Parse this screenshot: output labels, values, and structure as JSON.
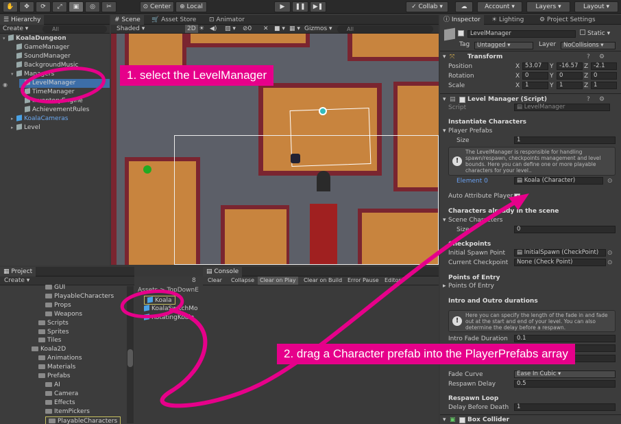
{
  "toolbar": {
    "pivot": "Center",
    "space": "Local",
    "collab": "Collab",
    "account": "Account",
    "layers": "Layers",
    "layout": "Layout"
  },
  "hierarchy": {
    "tab": "Hierarchy",
    "create": "Create",
    "search_placeholder": "All",
    "items": [
      {
        "label": "KoalaDungeon",
        "level": 0,
        "bold": true
      },
      {
        "label": "GameManager",
        "level": 1
      },
      {
        "label": "SoundManager",
        "level": 1
      },
      {
        "label": "BackgroundMusic",
        "level": 1
      },
      {
        "label": "Managers",
        "level": 1
      },
      {
        "label": "LevelManager",
        "level": 2
      },
      {
        "label": "TimeManager",
        "level": 2
      },
      {
        "label": "InventoryEngine",
        "level": 2
      },
      {
        "label": "AchievementRules",
        "level": 2
      },
      {
        "label": "KoalaCameras",
        "level": 1,
        "blue": true
      },
      {
        "label": "Level",
        "level": 1
      }
    ]
  },
  "scene": {
    "tabs": [
      "Scene",
      "Asset Store",
      "Animator"
    ],
    "shaded": "Shaded",
    "mode2d": "2D",
    "gizmos": "Gizmos",
    "search": "All"
  },
  "project": {
    "tab": "Project",
    "create": "Create",
    "items": [
      {
        "label": "GUI",
        "level": 2
      },
      {
        "label": "PlayableCharacters",
        "level": 2
      },
      {
        "label": "Props",
        "level": 2
      },
      {
        "label": "Weapons",
        "level": 2
      },
      {
        "label": "Scripts",
        "level": 1
      },
      {
        "label": "Sprites",
        "level": 1
      },
      {
        "label": "Tiles",
        "level": 1
      },
      {
        "label": "Koala2D",
        "level": 0
      },
      {
        "label": "Animations",
        "level": 1
      },
      {
        "label": "Materials",
        "level": 1
      },
      {
        "label": "Prefabs",
        "level": 1
      },
      {
        "label": "AI",
        "level": 2
      },
      {
        "label": "Camera",
        "level": 2
      },
      {
        "label": "Effects",
        "level": 2
      },
      {
        "label": "ItemPickers",
        "level": 2
      },
      {
        "label": "PlayableCharacters",
        "level": 2
      }
    ],
    "breadcrumb": "Assets > TopDownE",
    "count": "8",
    "assets": [
      "Koala",
      "KoalaSwitchMo",
      "RotatingKoala"
    ]
  },
  "console": {
    "tab": "Console",
    "buttons": [
      "Clear",
      "Collapse",
      "Clear on Play",
      "Clear on Build",
      "Error Pause",
      "Editor"
    ]
  },
  "inspector": {
    "tabs": [
      "Inspector",
      "Lighting",
      "Project Settings"
    ],
    "object_name": "LevelManager",
    "static": "Static",
    "tag_label": "Tag",
    "tag_value": "Untagged",
    "layer_label": "Layer",
    "layer_value": "NoCollisions",
    "transform": {
      "title": "Transform",
      "rows": [
        {
          "label": "Position",
          "x": "53.07",
          "y": "-16.57",
          "z": "-2.1"
        },
        {
          "label": "Rotation",
          "x": "0",
          "y": "0",
          "z": "0"
        },
        {
          "label": "Scale",
          "x": "1",
          "y": "1",
          "z": "1"
        }
      ]
    },
    "level_manager": {
      "title": "Level Manager (Script)",
      "script_label": "Script",
      "script_value": "LevelManager",
      "instantiate": "Instantiate Characters",
      "player_prefabs": "Player Prefabs",
      "size_label": "Size",
      "size_value": "1",
      "help1": "The LevelManager is responsible for handling spawn/respawn, checkpoints management and level bounds. Here you can define one or more playable characters for your level..",
      "element0_label": "Element 0",
      "element0_value": "Koala (Character)",
      "auto_attr": "Auto Attribute Player",
      "chars_already": "Characters already in the scene",
      "scene_chars": "Scene Characters",
      "scene_size_label": "Size",
      "scene_size_value": "0",
      "checkpoints": "Checkpoints",
      "initial_spawn_label": "Initial Spawn Point",
      "initial_spawn_value": "InitialSpawn (CheckPoint)",
      "current_cp_label": "Current Checkpoint",
      "current_cp_value": "None (Check Point)",
      "points_of_entry": "Points of Entry",
      "points_of_entry_sub": "Points Of Entry",
      "intro_outro": "Intro and Outro durations",
      "help2": "Here you can specify the length of the fade in and fade out at the start and end of your level. You can also determine the delay before a respawn.",
      "intro_fade_label": "Intro Fade Duration",
      "intro_fade_value": "0.1",
      "fade_curve_label": "Fade Curve",
      "fade_curve_value": "Ease In Cubic",
      "respawn_delay_label": "Respawn Delay",
      "respawn_delay_value": "0.5",
      "respawn_loop": "Respawn Loop",
      "delay_before_death_label": "Delay Before Death",
      "delay_before_death_value": "1"
    },
    "box_collider": "Box Collider"
  },
  "annotations": {
    "step1": "1. select the LevelManager",
    "step2": "2. drag a Character prefab into the PlayerPrefabs array"
  },
  "colors": {
    "accent_pink": "#e6008a",
    "selection_blue": "#3d6ea8"
  }
}
